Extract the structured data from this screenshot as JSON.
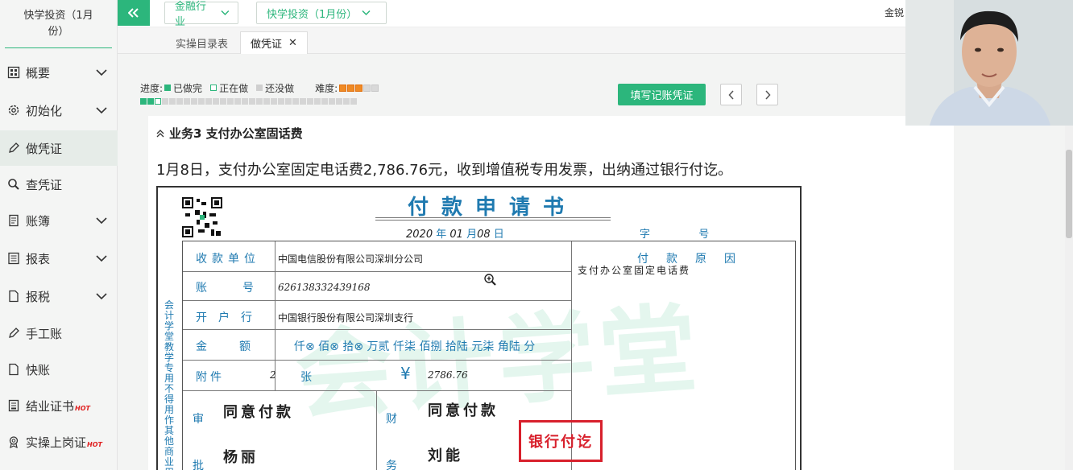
{
  "sidebar": {
    "title": "快学投资（1月份）",
    "items": [
      {
        "label": "概要",
        "icon": "overview-icon",
        "expandable": true
      },
      {
        "label": "初始化",
        "icon": "gear-icon",
        "expandable": true
      },
      {
        "label": "做凭证",
        "icon": "pencil-icon",
        "expandable": false,
        "active": true
      },
      {
        "label": "查凭证",
        "icon": "search-icon",
        "expandable": false
      },
      {
        "label": "账簿",
        "icon": "ledger-icon",
        "expandable": true
      },
      {
        "label": "报表",
        "icon": "report-icon",
        "expandable": true
      },
      {
        "label": "报税",
        "icon": "document-icon",
        "expandable": true
      },
      {
        "label": "手工账",
        "icon": "pencil-icon",
        "expandable": false
      },
      {
        "label": "快账",
        "icon": "document-icon",
        "expandable": false
      },
      {
        "label": "结业证书",
        "icon": "certificate-icon",
        "badge": "HOT"
      },
      {
        "label": "实操上岗证",
        "icon": "badge-icon",
        "badge": "HOT"
      }
    ]
  },
  "topbar": {
    "industry_select": "金融行业",
    "company_select": "快学投资（1月份）",
    "user_name": "金锐"
  },
  "tabs": [
    {
      "label": "实操目录表",
      "active": false
    },
    {
      "label": "做凭证",
      "active": true,
      "closable": true
    }
  ],
  "progress": {
    "label": "进度:",
    "legend_done": "已做完",
    "legend_doing": "正在做",
    "legend_todo": "还没做",
    "difficulty_label": "难度:",
    "difficulty_stars": 3,
    "difficulty_max": 5,
    "done_count": 2,
    "current_index": 3,
    "total": 30
  },
  "actions": {
    "fill_voucher": "填写记账凭证"
  },
  "task": {
    "title": "业务3 支付办公室固话费",
    "description": "1月8日，支付办公室固定电话费2,786.76元，收到增值税专用发票，出纳通过银行付讫。"
  },
  "voucher": {
    "title": "付款申请书",
    "date_year": "2020",
    "date_year_unit": "年",
    "date_month": "01",
    "date_month_unit": "月",
    "date_day": "08",
    "date_day_unit": "日",
    "zi_label": "字",
    "hao_label": "号",
    "payee_label": "收款单位",
    "payee_value": "中国电信股份有限公司深圳分公司",
    "account_label": "账号",
    "account_value": "626138332439168",
    "bank_label": "开户行",
    "bank_value": "中国银行股份有限公司深圳支行",
    "amount_label": "金额",
    "amount_words": "仟⊗ 佰⊗ 拾⊗ 万贰 仟柒 佰捌 拾陆 元柒 角陆 分",
    "attachment_label": "附件",
    "attachment_count": "2",
    "attachment_unit": "张",
    "currency_symbol": "¥",
    "amount_number": "2786.76",
    "reason_label": "付款原因",
    "reason_value": "支付办公室固定电话费",
    "approve_label_1": "审",
    "approve_label_2": "批",
    "approve_text": "同意付款",
    "approver": "杨丽",
    "finance_label_1": "财",
    "finance_label_2": "务",
    "finance_text": "同意付款",
    "finance_person": "刘能",
    "stamp": "银行付讫",
    "side_note": "会计学堂教学专用不得用作其他商业用途",
    "watermark": "会计学堂"
  }
}
